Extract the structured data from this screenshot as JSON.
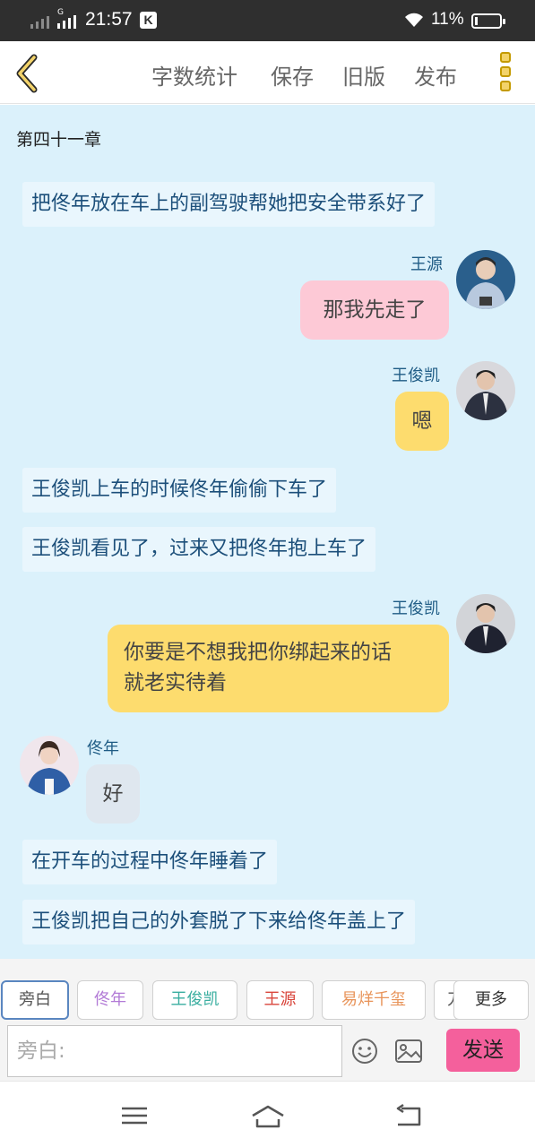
{
  "status_bar": {
    "time": "21:57",
    "network_mark": "G",
    "app_badge": "K",
    "battery_percent": "11%",
    "battery_level": 0.11
  },
  "toolbar": {
    "back_icon": "chevron-left-icon",
    "word_count_label": "字数统计",
    "save_label": "保存",
    "old_version_label": "旧版",
    "publish_label": "发布",
    "more_icon": "vertical-dots-icon"
  },
  "chapter_title": "第四十一章",
  "messages": [
    {
      "type": "narration",
      "text": "把佟年放在车上的副驾驶帮她把安全带系好了"
    },
    {
      "type": "right",
      "speaker": "王源",
      "text": "那我先走了",
      "color": "#fdc9d6"
    },
    {
      "type": "right",
      "speaker": "王俊凯",
      "text": "嗯",
      "color": "#fddc6e"
    },
    {
      "type": "narration",
      "text": "王俊凯上车的时候佟年偷偷下车了"
    },
    {
      "type": "narration",
      "text": "王俊凯看见了，过来又把佟年抱上车了"
    },
    {
      "type": "right",
      "speaker": "王俊凯",
      "lines": [
        "你要是不想我把你绑起来的话",
        "就老实待着"
      ],
      "color": "#fddc6e"
    },
    {
      "type": "left",
      "speaker": "佟年",
      "text": "好",
      "color": "#dfe7ef"
    },
    {
      "type": "narration",
      "text": "在开车的过程中佟年睡着了"
    },
    {
      "type": "narration",
      "text": "王俊凯把自己的外套脱了下来给佟年盖上了"
    }
  ],
  "roles": [
    {
      "label": "旁白",
      "color": "#555555",
      "active": true
    },
    {
      "label": "佟年",
      "color": "#b27ad6",
      "active": false
    },
    {
      "label": "王俊凯",
      "color": "#3aaea0",
      "active": false
    },
    {
      "label": "王源",
      "color": "#d9463c",
      "active": false
    },
    {
      "label": "易烊千玺",
      "color": "#e8945a",
      "active": false
    },
    {
      "label": "刀",
      "color": "#555555",
      "active": false
    }
  ],
  "more_roles_label": "更多",
  "input": {
    "placeholder": "旁白:",
    "emoji_icon": "smiley-icon",
    "image_icon": "image-icon",
    "send_label": "发送"
  },
  "nav_bar": {
    "menu_icon": "menu-icon",
    "home_icon": "home-icon",
    "back_icon": "back-arrow-icon"
  }
}
